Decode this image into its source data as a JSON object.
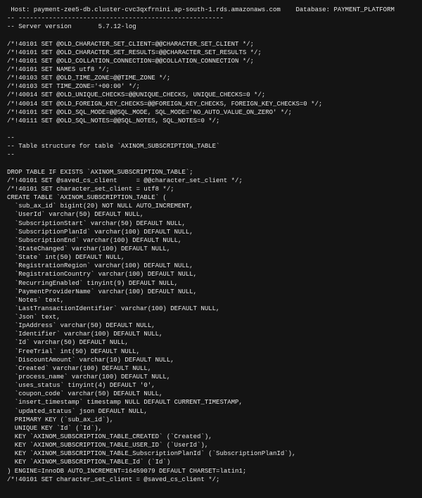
{
  "lines": [
    " Host: payment-zee5-db.cluster-cvc3qxfrnini.ap-south-1.rds.amazonaws.com    Database: PAYMENT_PLATFORM",
    "-- ------------------------------------------------------",
    "-- Server version       5.7.12-log",
    "",
    "/*!40101 SET @OLD_CHARACTER_SET_CLIENT=@@CHARACTER_SET_CLIENT */;",
    "/*!40101 SET @OLD_CHARACTER_SET_RESULTS=@@CHARACTER_SET_RESULTS */;",
    "/*!40101 SET @OLD_COLLATION_CONNECTION=@@COLLATION_CONNECTION */;",
    "/*!40101 SET NAMES utf8 */;",
    "/*!40103 SET @OLD_TIME_ZONE=@@TIME_ZONE */;",
    "/*!40103 SET TIME_ZONE='+00:00' */;",
    "/*!40014 SET @OLD_UNIQUE_CHECKS=@@UNIQUE_CHECKS, UNIQUE_CHECKS=0 */;",
    "/*!40014 SET @OLD_FOREIGN_KEY_CHECKS=@@FOREIGN_KEY_CHECKS, FOREIGN_KEY_CHECKS=0 */;",
    "/*!40101 SET @OLD_SQL_MODE=@@SQL_MODE, SQL_MODE='NO_AUTO_VALUE_ON_ZERO' */;",
    "/*!40111 SET @OLD_SQL_NOTES=@@SQL_NOTES, SQL_NOTES=0 */;",
    "",
    "--",
    "-- Table structure for table `AXINOM_SUBSCRIPTION_TABLE`",
    "--",
    "",
    "DROP TABLE IF EXISTS `AXINOM_SUBSCRIPTION_TABLE`;",
    "/*!40101 SET @saved_cs_client     = @@character_set_client */;",
    "/*!40101 SET character_set_client = utf8 */;",
    "CREATE TABLE `AXINOM_SUBSCRIPTION_TABLE` (",
    "  `sub_ax_id` bigint(20) NOT NULL AUTO_INCREMENT,",
    "  `UserId` varchar(50) DEFAULT NULL,",
    "  `SubscriptionStart` varchar(50) DEFAULT NULL,",
    "  `SubscriptionPlanId` varchar(100) DEFAULT NULL,",
    "  `SubscriptionEnd` varchar(100) DEFAULT NULL,",
    "  `StateChanged` varchar(100) DEFAULT NULL,",
    "  `State` int(50) DEFAULT NULL,",
    "  `RegistrationRegion` varchar(100) DEFAULT NULL,",
    "  `RegistrationCountry` varchar(100) DEFAULT NULL,",
    "  `RecurringEnabled` tinyint(9) DEFAULT NULL,",
    "  `PaymentProviderName` varchar(100) DEFAULT NULL,",
    "  `Notes` text,",
    "  `LastTransactionIdentifier` varchar(100) DEFAULT NULL,",
    "  `Json` text,",
    "  `IpAddress` varchar(50) DEFAULT NULL,",
    "  `Identifier` varchar(100) DEFAULT NULL,",
    "  `Id` varchar(50) DEFAULT NULL,",
    "  `FreeTrial` int(50) DEFAULT NULL,",
    "  `DiscountAmount` varchar(10) DEFAULT NULL,",
    "  `Created` varchar(100) DEFAULT NULL,",
    "  `process_name` varchar(100) DEFAULT NULL,",
    "  `uses_status` tinyint(4) DEFAULT '0',",
    "  `coupon_code` varchar(50) DEFAULT NULL,",
    "  `insert_timestamp` timestamp NULL DEFAULT CURRENT_TIMESTAMP,",
    "  `updated_status` json DEFAULT NULL,",
    "  PRIMARY KEY (`sub_ax_id`),",
    "  UNIQUE KEY `Id` (`Id`),",
    "  KEY `AXINOM_SUBSCRIPTION_TABLE_CREATED` (`Created`),",
    "  KEY `AXINOM_SUBSCRIPTION_TABLE_USER_ID` (`UserId`),",
    "  KEY `AXINOM_SUBSCRIPTION_TABLE_SubscriptionPlanId` (`SubscriptionPlanId`),",
    "  KEY `AXINOM_SUBSCRIPTION_TABLE_Id` (`Id`)",
    ") ENGINE=InnoDB AUTO_INCREMENT=16459079 DEFAULT CHARSET=latin1;",
    "/*!40101 SET character_set_client = @saved_cs_client */;",
    ""
  ]
}
